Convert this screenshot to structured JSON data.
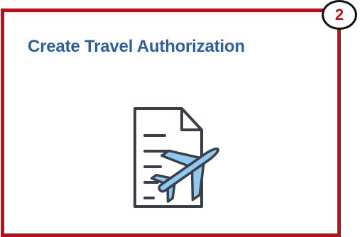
{
  "tile": {
    "title": "Create Travel Authorization",
    "icon": "document-airplane-icon",
    "frame_color": "#b5121b",
    "title_color": "#2f5f9a"
  },
  "callout": {
    "step_number": "2"
  }
}
